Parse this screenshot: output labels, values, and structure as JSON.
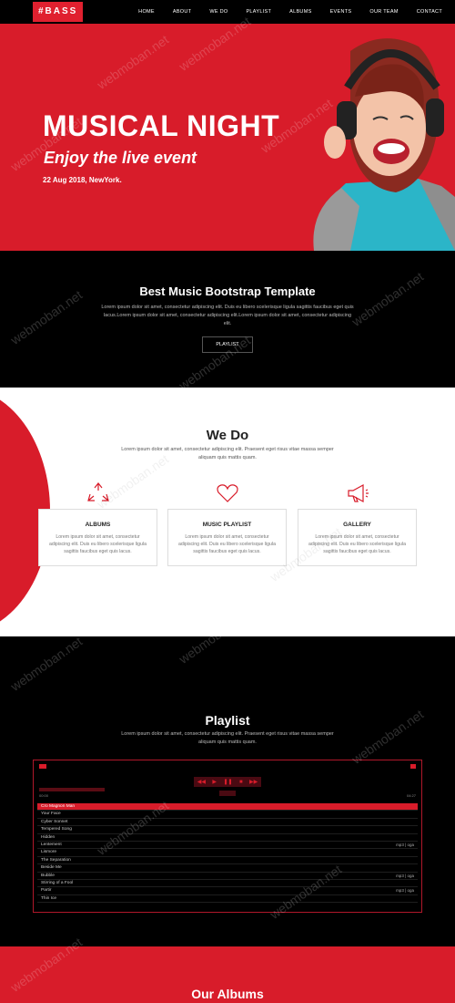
{
  "nav": {
    "logo": "#BASS",
    "items": [
      "HOME",
      "ABOUT",
      "WE DO",
      "PLAYLIST",
      "ALBUMS",
      "EVENTS",
      "OUR TEAM",
      "CONTACT"
    ]
  },
  "hero": {
    "title": "MUSICAL NIGHT",
    "subtitle": "Enjoy the live event",
    "date": "22 Aug 2018, NewYork."
  },
  "intro": {
    "title": "Best Music Bootstrap Template",
    "text": "Lorem ipsum dolor sit amet, consectetur adipiscing elit. Duis eu libero scelerisque ligula sagittis faucibus eget quis lacus.Lorem ipsum dolor sit amet, consectetur adipiscing elit.Lorem ipsum dolor sit amet, consectetur adipiscing elit.",
    "button": "PLAYLIST"
  },
  "wedo": {
    "title": "We Do",
    "lead": "Lorem ipsum dolor sit amet, consectetur adipiscing elit. Praesent eget risus vitae massa semper aliquam quis mattis quam.",
    "cards": [
      {
        "icon": "recycle-icon",
        "title": "ALBUMS",
        "text": "Lorem ipsum dolor sit amet, consectetur adipiscing elit. Duis eu libero scelerisque ligula sagittis faucibus eget quis lacus."
      },
      {
        "icon": "heart-icon",
        "title": "MUSIC PLAYLIST",
        "text": "Lorem ipsum dolor sit amet, consectetur adipiscing elit. Duis eu libero scelerisque ligula sagittis faucibus eget quis lacus."
      },
      {
        "icon": "megaphone-icon",
        "title": "GALLERY",
        "text": "Lorem ipsum dolor sit amet, consectetur adipiscing elit. Duis eu libero scelerisque ligula sagittis faucibus eget quis lacus."
      }
    ]
  },
  "playlist": {
    "title": "Playlist",
    "lead": "Lorem ipsum dolor sit amet, consectetur adipiscing elit. Praesent eget risus vitae massa semper aliquam quis mattis quam.",
    "time_current": "00:00",
    "time_total": "04:27",
    "tracks": [
      {
        "name": "Cro Magnon Man",
        "fmt": ""
      },
      {
        "name": "Your Face",
        "fmt": ""
      },
      {
        "name": "Cyber Sonnet",
        "fmt": ""
      },
      {
        "name": "Tempered Song",
        "fmt": ""
      },
      {
        "name": "Hidden",
        "fmt": ""
      },
      {
        "name": "Lentement",
        "fmt": "mp3 | oga"
      },
      {
        "name": "Lismore",
        "fmt": ""
      },
      {
        "name": "The Separation",
        "fmt": ""
      },
      {
        "name": "Beside Me",
        "fmt": ""
      },
      {
        "name": "Bubble",
        "fmt": "mp3 | oga"
      },
      {
        "name": "Stirring of a Fool",
        "fmt": ""
      },
      {
        "name": "Partir",
        "fmt": "mp3 | oga"
      },
      {
        "name": "Thin Ice",
        "fmt": ""
      }
    ]
  },
  "albums": {
    "title": "Our Albums"
  },
  "watermark": "webmoban.net",
  "colors": {
    "accent": "#d81c2a",
    "dark": "#000000"
  }
}
